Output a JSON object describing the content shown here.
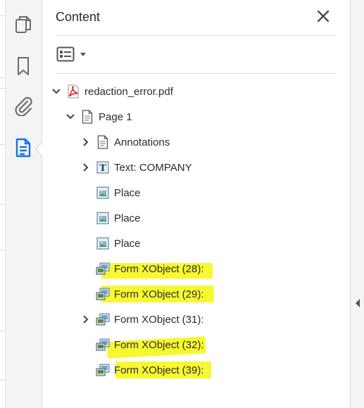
{
  "panel": {
    "title": "Content",
    "close_icon": "close-icon",
    "options_icon": "list-options-icon"
  },
  "rail": {
    "items": [
      {
        "name": "pages-icon"
      },
      {
        "name": "bookmarks-icon"
      },
      {
        "name": "attachments-icon"
      },
      {
        "name": "content-icon",
        "active": true
      }
    ]
  },
  "tree": {
    "root": {
      "label": "redaction_error.pdf",
      "icon": "pdf-file-icon"
    },
    "page": {
      "label": "Page 1",
      "icon": "page-icon"
    },
    "items": [
      {
        "label": "Annotations",
        "icon": "annotations-icon",
        "expandable": true,
        "highlighted": false
      },
      {
        "label": "Text: COMPANY",
        "icon": "text-element-icon",
        "expandable": true,
        "highlighted": false
      },
      {
        "label": "Place",
        "icon": "placed-image-icon",
        "expandable": false,
        "highlighted": false
      },
      {
        "label": "Place",
        "icon": "placed-image-icon",
        "expandable": false,
        "highlighted": false
      },
      {
        "label": "Place",
        "icon": "placed-image-icon",
        "expandable": false,
        "highlighted": false
      },
      {
        "label": "Form XObject (28):",
        "icon": "form-xobject-icon",
        "expandable": false,
        "highlighted": true
      },
      {
        "label": "Form XObject (29):",
        "icon": "form-xobject-icon",
        "expandable": false,
        "highlighted": true
      },
      {
        "label": "Form XObject (31):",
        "icon": "form-xobject-icon",
        "expandable": true,
        "highlighted": false
      },
      {
        "label": "Form XObject (32):",
        "icon": "form-xobject-icon",
        "expandable": false,
        "highlighted": true
      },
      {
        "label": "Form XObject (39):",
        "icon": "form-xobject-icon",
        "expandable": false,
        "highlighted": true
      }
    ]
  },
  "colors": {
    "accent": "#1473e6",
    "highlight": "#f7f71a",
    "pdf_red": "#d6201f"
  }
}
